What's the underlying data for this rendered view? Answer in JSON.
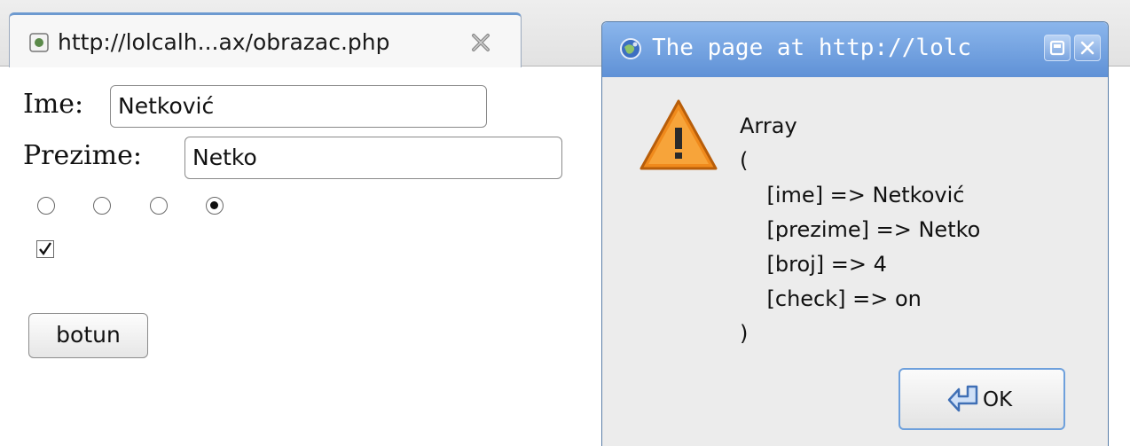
{
  "browser": {
    "tab_title": "http://lolcalh...ax/obrazac.php"
  },
  "form": {
    "ime_label": "Ime:",
    "ime_value": "Netković",
    "prezime_label": "Prezime:",
    "prezime_value": "Netko",
    "radio_selected_index": 3,
    "radio_count": 4,
    "checkbox_checked": true,
    "button_label": "botun"
  },
  "dialog": {
    "title": "The page at http://lolc",
    "message_lines": [
      "Array",
      "(",
      "    [ime] => Netković",
      "    [prezime] => Netko",
      "    [broj] => 4",
      "    [check] => on",
      ")"
    ],
    "ok_label": "OK"
  },
  "colors": {
    "dialog_titlebar": "#5f91d6",
    "warning": "#f08a1c"
  }
}
